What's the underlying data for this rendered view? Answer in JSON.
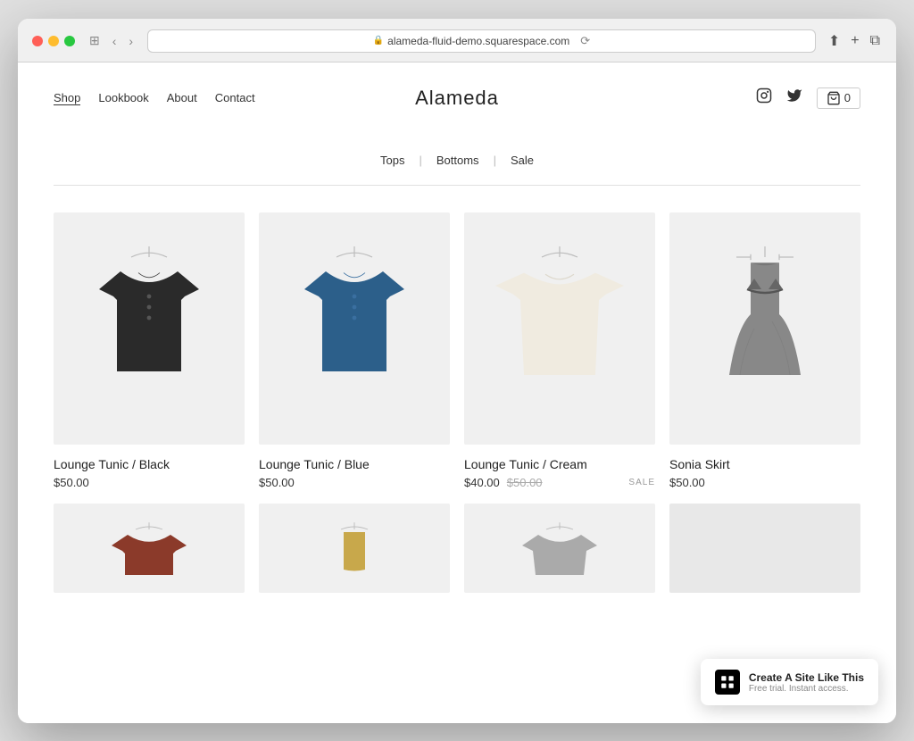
{
  "browser": {
    "url": "alameda-fluid-demo.squarespace.com",
    "reload_label": "⟳"
  },
  "nav": {
    "links": [
      {
        "label": "Shop",
        "active": true
      },
      {
        "label": "Lookbook",
        "active": false
      },
      {
        "label": "About",
        "active": false
      },
      {
        "label": "Contact",
        "active": false
      }
    ],
    "site_title": "Alameda",
    "cart_count": "0",
    "cart_label": "0"
  },
  "filter": {
    "categories": [
      {
        "label": "Tops"
      },
      {
        "label": "Bottoms"
      },
      {
        "label": "Sale"
      }
    ]
  },
  "products": [
    {
      "name": "Lounge Tunic / Black",
      "price": "$50.00",
      "original_price": null,
      "on_sale": false,
      "color": "black"
    },
    {
      "name": "Lounge Tunic / Blue",
      "price": "$50.00",
      "original_price": null,
      "on_sale": false,
      "color": "blue"
    },
    {
      "name": "Lounge Tunic / Cream",
      "price": "$40.00",
      "original_price": "$50.00",
      "on_sale": true,
      "color": "cream"
    },
    {
      "name": "Sonia Skirt",
      "price": "$50.00",
      "original_price": null,
      "on_sale": false,
      "color": "gray"
    }
  ],
  "second_row": [
    {
      "color": "rust"
    },
    {
      "color": "gold"
    },
    {
      "color": "gray"
    },
    {
      "color": "none"
    }
  ],
  "promo": {
    "title": "Create A Site Like This",
    "subtitle": "Free trial. Instant access."
  },
  "icons": {
    "instagram": "Instagram icon",
    "twitter": "Twitter icon",
    "cart": "Shopping cart icon"
  }
}
